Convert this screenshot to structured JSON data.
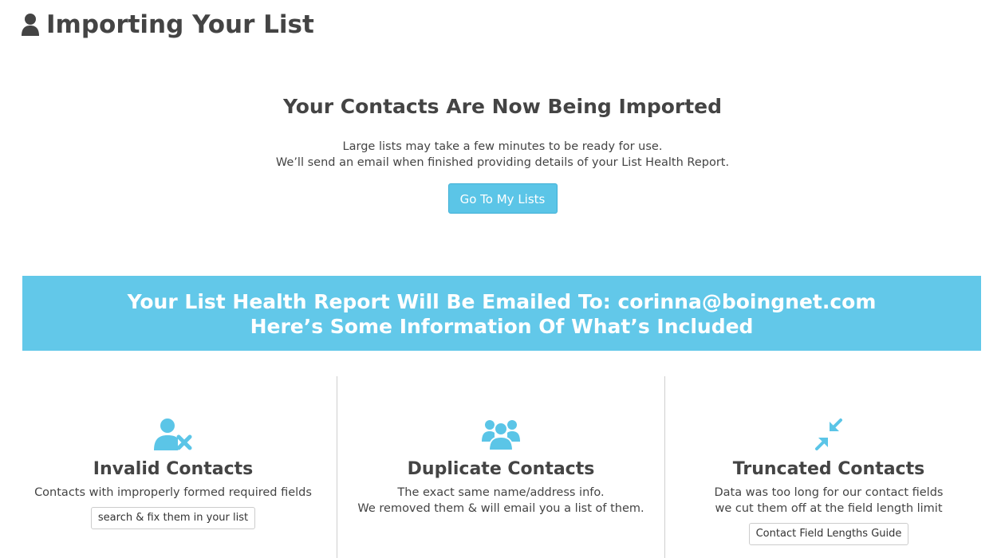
{
  "header": {
    "title": "Importing Your List",
    "icon": "user-icon"
  },
  "import": {
    "heading": "Your Contacts Are Now Being Imported",
    "line1": "Large lists may take a few minutes to be ready for use.",
    "line2": "We’ll send an email when finished providing details of your List Health Report.",
    "button_label": "Go To My Lists"
  },
  "banner": {
    "line1": "Your List Health Report Will Be Emailed To: corinna@boingnet.com",
    "line2": "Here’s Some Information Of What’s Included"
  },
  "features": [
    {
      "icon": "invalid-user-icon",
      "title": "Invalid Contacts",
      "desc_line1": "Contacts with improperly formed required fields",
      "desc_line2": "",
      "button_label": "search & fix them in your list"
    },
    {
      "icon": "users-group-icon",
      "title": "Duplicate Contacts",
      "desc_line1": "The exact same name/address info.",
      "desc_line2": "We removed them & will email you a list of them."
    },
    {
      "icon": "compress-arrows-icon",
      "title": "Truncated Contacts",
      "desc_line1": "Data was too long for our contact fields",
      "desc_line2": "we cut them off at the field length limit",
      "button_label": "Contact Field Lengths Guide"
    }
  ],
  "colors": {
    "accent": "#5bc5e7",
    "banner": "#62c8e9",
    "text": "#444444"
  }
}
